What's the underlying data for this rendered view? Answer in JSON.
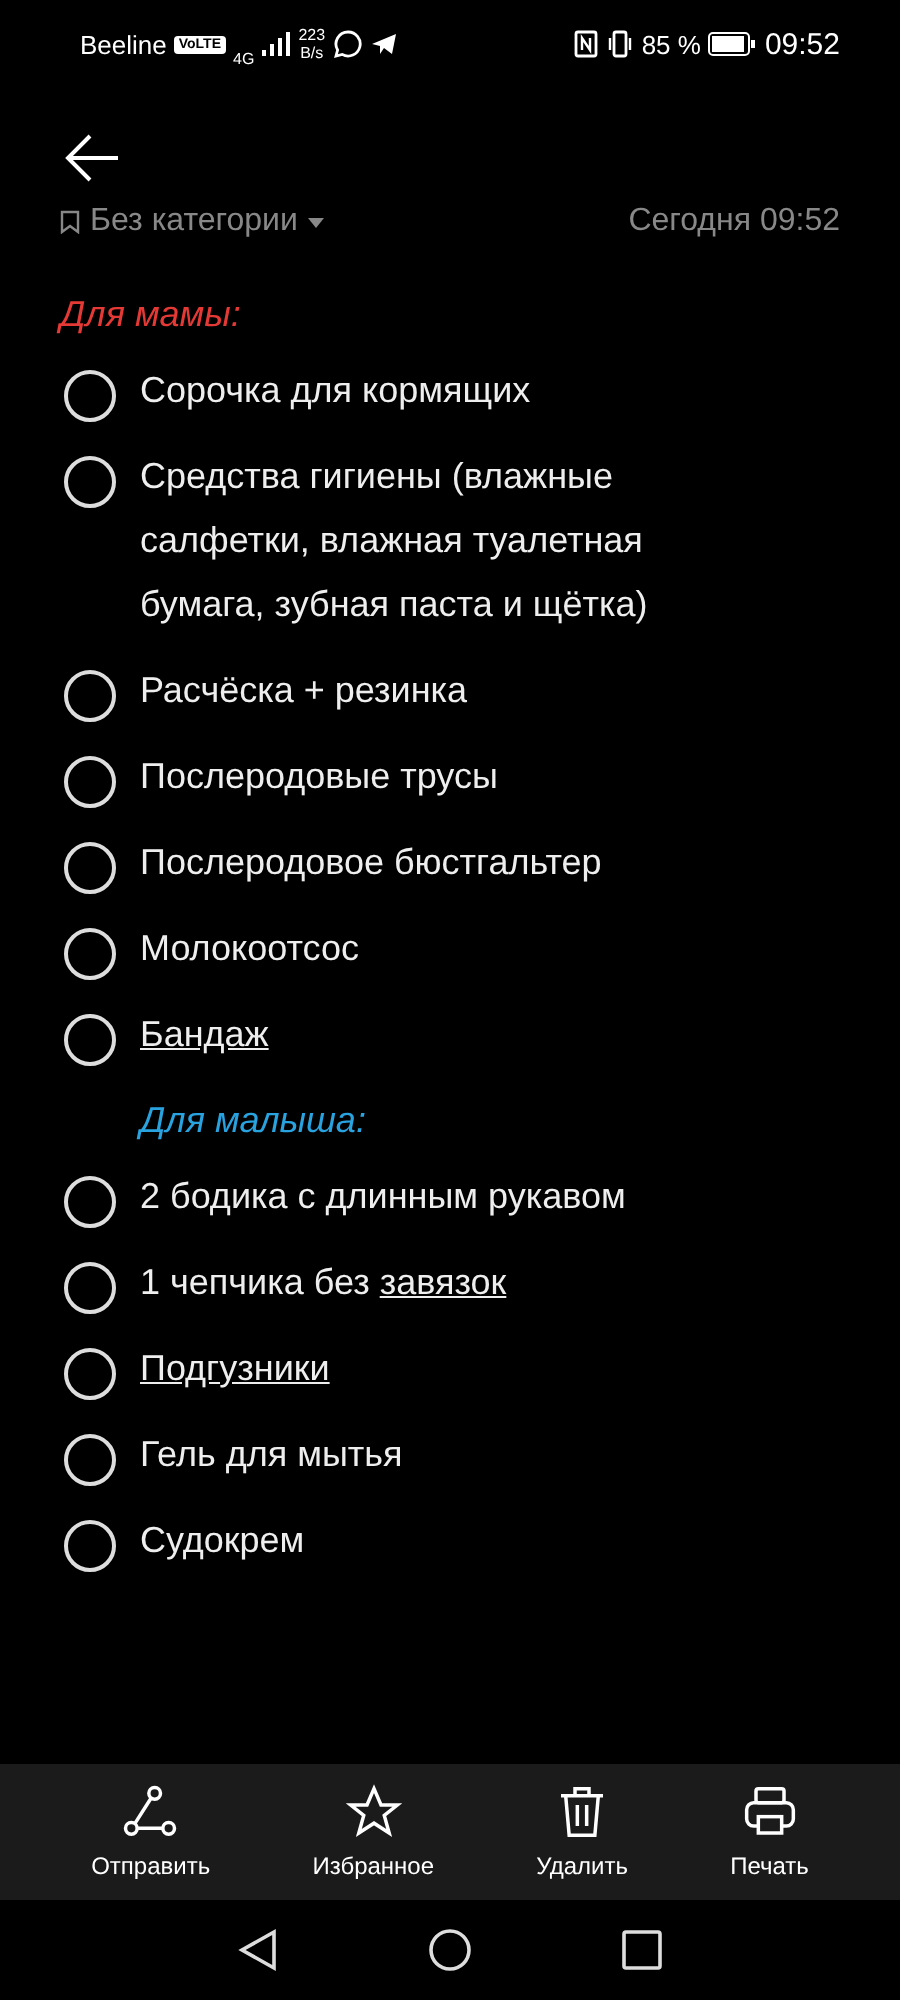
{
  "status_bar": {
    "carrier": "Beeline",
    "volte": "VoLTE",
    "network": "4G",
    "speed_value": "223",
    "speed_unit": "B/s",
    "battery_percent": "85 %",
    "time": "09:52"
  },
  "note": {
    "category": "Без категории",
    "date": "Сегодня 09:52"
  },
  "sections": [
    {
      "title": "Для мамы:",
      "color": "#e53935",
      "indented": false,
      "items": [
        {
          "checked": false,
          "parts": [
            {
              "text": "Сорочка для кормящих",
              "underlined": false
            }
          ]
        },
        {
          "checked": false,
          "parts": [
            {
              "text": "Средства гигиены (влажные салфетки, влажная туалетная бумага, зубная паста и щётка)",
              "underlined": false
            }
          ]
        },
        {
          "checked": false,
          "parts": [
            {
              "text": "Расчёска + резинка",
              "underlined": false
            }
          ]
        },
        {
          "checked": false,
          "parts": [
            {
              "text": "Послеродовые трусы",
              "underlined": false
            }
          ]
        },
        {
          "checked": false,
          "parts": [
            {
              "text": "Послеродовое бюстгальтер",
              "underlined": false
            }
          ]
        },
        {
          "checked": false,
          "parts": [
            {
              "text": "Молокоотсос",
              "underlined": false
            }
          ]
        },
        {
          "checked": false,
          "parts": [
            {
              "text": "Бандаж",
              "underlined": true
            }
          ]
        }
      ]
    },
    {
      "title": "Для малыша:",
      "color": "#29a3e0",
      "indented": true,
      "items": [
        {
          "checked": false,
          "parts": [
            {
              "text": "2 бодика с длинным рукавом",
              "underlined": false
            }
          ]
        },
        {
          "checked": false,
          "parts": [
            {
              "text": "1 чепчика без ",
              "underlined": false
            },
            {
              "text": "завязок",
              "underlined": true
            }
          ]
        },
        {
          "checked": false,
          "parts": [
            {
              "text": "Подгузники",
              "underlined": true
            }
          ]
        },
        {
          "checked": false,
          "parts": [
            {
              "text": "Гель для мытья",
              "underlined": false
            }
          ]
        },
        {
          "checked": false,
          "parts": [
            {
              "text": "Судокрем",
              "underlined": false
            }
          ]
        }
      ]
    }
  ],
  "toolbar": [
    {
      "kind": "share",
      "label": "Отправить"
    },
    {
      "kind": "favorite",
      "label": "Избранное"
    },
    {
      "kind": "delete",
      "label": "Удалить"
    },
    {
      "kind": "print",
      "label": "Печать"
    }
  ]
}
